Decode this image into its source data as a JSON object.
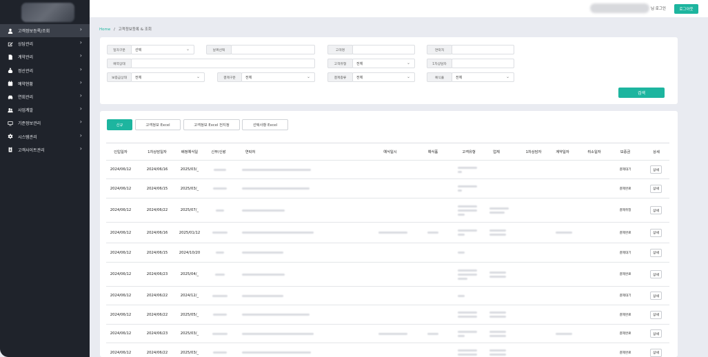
{
  "sidebar": {
    "items": [
      {
        "label": "고객정보등록/조회",
        "icon": "user-icon"
      },
      {
        "label": "상담관리",
        "icon": "edit-icon"
      },
      {
        "label": "계약관리",
        "icon": "document-icon"
      },
      {
        "label": "정산관리",
        "icon": "money-bag-icon"
      },
      {
        "label": "예약현황",
        "icon": "calendar-icon"
      },
      {
        "label": "연회관리",
        "icon": "car-icon"
      },
      {
        "label": "사업계발",
        "icon": "people-icon"
      },
      {
        "label": "기준정보관리",
        "icon": "monitor-icon"
      },
      {
        "label": "시스템관리",
        "icon": "gear-icon"
      },
      {
        "label": "고객사이트관리",
        "icon": "id-card-icon"
      }
    ]
  },
  "topbar": {
    "user_suffix": "님 로그인",
    "logout_label": "로그아웃"
  },
  "breadcrumb": {
    "home": "Home",
    "sep": "/",
    "current": "고객정보등록 & 조회"
  },
  "filters": {
    "date_type_label": "일자구분",
    "date_type_value": "선택",
    "date_select_label": "날짜선택",
    "name_label": "고객명",
    "contact_label": "연락처",
    "status_label": "예약상태",
    "type_label": "고객유형",
    "type_value": "전체",
    "consultant_label": "1차상담자",
    "deposit_label": "보증금상태",
    "deposit_value": "전체",
    "pay_type_label": "결제구분",
    "pay_type_value": "전체",
    "pay_kind_label": "결제종류",
    "pay_kind_value": "전체",
    "hall_label": "예식홀",
    "hall_value": "전체",
    "search_label": "검색"
  },
  "actions": {
    "new": "신규",
    "excel": "고객정보 Excel",
    "excel_all": "고객정보 Excel 전지정",
    "excel_selected": "선택사항 Excel"
  },
  "table": {
    "headers": [
      "인입일자",
      "1차상담일자",
      "배정예식일",
      "신부/신랑",
      "연락처",
      "예식일시",
      "예식홀",
      "고객유형",
      "업체",
      "1차상담자",
      "계약일자",
      "취소일자",
      "보증금",
      "상세"
    ],
    "detail_label": "상세",
    "rows": [
      {
        "in": "2024/06/12",
        "first": "2024/06/16",
        "wed": "2025/03/_",
        "deposit": "결제대기"
      },
      {
        "in": "2024/06/12",
        "first": "2024/06/15",
        "wed": "2025/03/_",
        "deposit": "결제완료"
      },
      {
        "in": "2024/06/12",
        "first": "2024/06/22",
        "wed": "2025/07/_",
        "deposit": "결제취청"
      },
      {
        "in": "2024/06/12",
        "first": "2024/06/16",
        "wed": "2025/01/12",
        "deposit": "결제완료"
      },
      {
        "in": "2024/06/12",
        "first": "2024/06/15",
        "wed": "2024/10/20",
        "deposit": "결제대기"
      },
      {
        "in": "2024/06/12",
        "first": "2024/06/23",
        "wed": "2025/04/_",
        "deposit": "결제완료"
      },
      {
        "in": "2024/06/12",
        "first": "2024/06/22",
        "wed": "2024/12/_",
        "deposit": "결제대기"
      },
      {
        "in": "2024/06/12",
        "first": "2024/06/22",
        "wed": "2025/05/_",
        "deposit": "결제완료"
      },
      {
        "in": "2024/06/12",
        "first": "2024/06/23",
        "wed": "2025/03/_",
        "deposit": "결제완료"
      },
      {
        "in": "2024/06/12",
        "first": "2024/06/22",
        "wed": "2025/03/_",
        "deposit": "결제완료"
      }
    ]
  },
  "colors": {
    "accent": "#1db59f",
    "sidebar": "#1f232b",
    "background": "#e9ebf1"
  }
}
